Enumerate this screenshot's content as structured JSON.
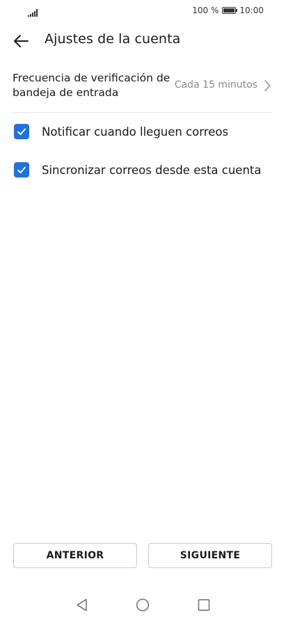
{
  "status_bar": {
    "battery_text": "100 %",
    "time": "10:00",
    "icons": [
      "signal-icon",
      "battery-icon"
    ]
  },
  "app_bar": {
    "title": "Ajustes de la cuenta",
    "back_icon": "arrow-left-icon"
  },
  "settings": {
    "frequency": {
      "label": "Frecuencia de verificación de bandeja de entrada",
      "value": "Cada 15 minutos"
    },
    "notify": {
      "label": "Notificar cuando lleguen correos",
      "checked": true
    },
    "sync": {
      "label": "Sincronizar correos desde esta cuenta",
      "checked": true
    }
  },
  "buttons": {
    "previous": "ANTERIOR",
    "next": "SIGUIENTE"
  },
  "colors": {
    "accent": "#1a73e8",
    "text_primary": "#1a1a1a",
    "text_secondary": "#8a8a8a",
    "divider": "#e6e6e6"
  },
  "nav_bar": {
    "icons": [
      "nav-back-icon",
      "nav-home-icon",
      "nav-recent-icon"
    ]
  }
}
